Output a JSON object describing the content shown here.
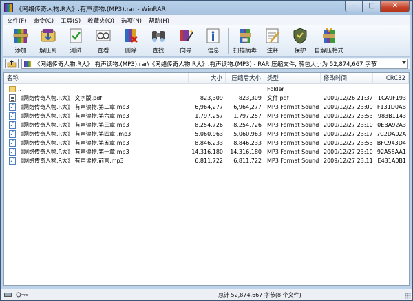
{
  "window": {
    "title": "《网络传奇人物.R大》.有声读物.(MP3).rar - WinRAR",
    "controls": {
      "minimize": "–",
      "maximize": "□",
      "close": "✕"
    }
  },
  "menu": [
    "文件(F)",
    "命令(C)",
    "工具(S)",
    "收藏夹(O)",
    "选项(N)",
    "帮助(H)"
  ],
  "toolbar": [
    {
      "label": "添加",
      "icon": "add-archive-icon"
    },
    {
      "label": "解压到",
      "icon": "extract-to-icon"
    },
    {
      "label": "测试",
      "icon": "test-icon"
    },
    {
      "label": "查看",
      "icon": "view-icon"
    },
    {
      "label": "删除",
      "icon": "delete-icon"
    },
    {
      "label": "查找",
      "icon": "find-icon"
    },
    {
      "label": "向导",
      "icon": "wizard-icon"
    },
    {
      "label": "信息",
      "icon": "info-icon"
    },
    {
      "label": "扫描病毒",
      "icon": "virus-scan-icon"
    },
    {
      "label": "注释",
      "icon": "comment-icon"
    },
    {
      "label": "保护",
      "icon": "protect-icon"
    },
    {
      "label": "自解压格式",
      "icon": "sfx-icon"
    }
  ],
  "path": {
    "text": "《网络传奇人物.R大》.有声读物.(MP3).rar\\《网络传奇人物.R大》.有声读物.(MP3) - RAR 压缩文件, 解包大小为 52,874,667 字节"
  },
  "columns": {
    "name": "名称",
    "size": "大小",
    "packed": "压缩后大小",
    "type": "类型",
    "modified": "修改时间",
    "crc": "CRC32"
  },
  "files": [
    {
      "name": "..",
      "size": "",
      "packed": "",
      "type": "Folder",
      "modified": "",
      "crc": "",
      "kind": "folder"
    },
    {
      "name": "《网络传奇人物.R大》.文字版.pdf",
      "size": "823,309",
      "packed": "823,309",
      "type": "文件 pdf",
      "modified": "2009/12/26 21:37",
      "crc": "1CA9F193",
      "kind": "pdf"
    },
    {
      "name": "《网络传奇人物.R大》.有声读物.第二章.mp3",
      "size": "6,964,277",
      "packed": "6,964,277",
      "type": "MP3 Format Sound",
      "modified": "2009/12/27 23:09",
      "crc": "F131D0AB",
      "kind": "mp3"
    },
    {
      "name": "《网络传奇人物.R大》.有声读物.第六章.mp3",
      "size": "1,797,257",
      "packed": "1,797,257",
      "type": "MP3 Format Sound",
      "modified": "2009/12/27 23:53",
      "crc": "983B1143",
      "kind": "mp3"
    },
    {
      "name": "《网络传奇人物.R大》.有声读物.第三章.mp3",
      "size": "8,254,726",
      "packed": "8,254,726",
      "type": "MP3 Format Sound",
      "modified": "2009/12/27 23:10",
      "crc": "0EBA92A3",
      "kind": "mp3"
    },
    {
      "name": "《网络传奇人物.R大》.有声读物.第四章..mp3",
      "size": "5,060,963",
      "packed": "5,060,963",
      "type": "MP3 Format Sound",
      "modified": "2009/12/27 23:17",
      "crc": "7C2DA02A",
      "kind": "mp3"
    },
    {
      "name": "《网络传奇人物.R大》.有声读物.第五章.mp3",
      "size": "8,846,233",
      "packed": "8,846,233",
      "type": "MP3 Format Sound",
      "modified": "2009/12/27 23:53",
      "crc": "BFC943D4",
      "kind": "mp3"
    },
    {
      "name": "《网络传奇人物.R大》.有声读物.第一章.mp3",
      "size": "14,316,180",
      "packed": "14,316,180",
      "type": "MP3 Format Sound",
      "modified": "2009/12/27 23:10",
      "crc": "92A58AA1",
      "kind": "mp3"
    },
    {
      "name": "《网络传奇人物.R大》.有声读物.前言.mp3",
      "size": "6,811,722",
      "packed": "6,811,722",
      "type": "MP3 Format Sound",
      "modified": "2009/12/27 23:11",
      "crc": "E431A0B1",
      "kind": "mp3"
    }
  ],
  "status": {
    "summary": "总计 52,874,667 字节(8 个文件)"
  },
  "colors": {
    "window_frame": "#bcd3ea",
    "close_button": "#c6432a",
    "toolbar_bg": "#eef4fa"
  }
}
